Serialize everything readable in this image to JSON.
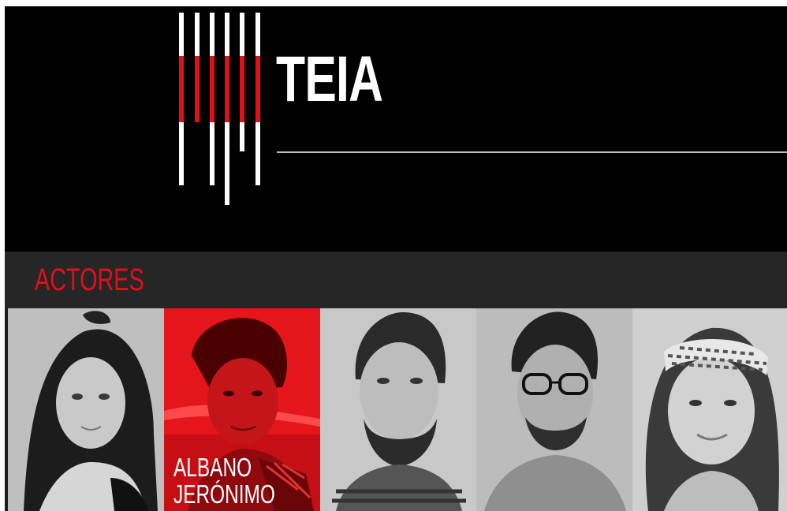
{
  "brand": {
    "name": "TEIA"
  },
  "section": {
    "title": "ACTORES"
  },
  "actors": [
    {
      "name_line1": "",
      "name_line2": "",
      "highlighted": false
    },
    {
      "name_line1": "ALBANO",
      "name_line2": "JERÓNIMO",
      "highlighted": true
    },
    {
      "name_line1": "",
      "name_line2": "",
      "highlighted": false
    },
    {
      "name_line1": "",
      "name_line2": "",
      "highlighted": false
    },
    {
      "name_line1": "",
      "name_line2": "",
      "highlighted": false
    }
  ],
  "colors": {
    "accent": "#e0101a",
    "header_bg": "#000000",
    "section_bg": "#262626"
  }
}
